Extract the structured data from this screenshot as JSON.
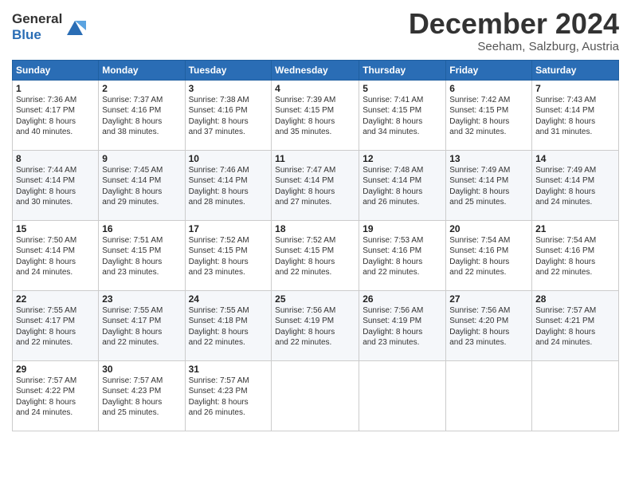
{
  "header": {
    "logo_line1": "General",
    "logo_line2": "Blue",
    "month_title": "December 2024",
    "location": "Seeham, Salzburg, Austria"
  },
  "calendar": {
    "days_of_week": [
      "Sunday",
      "Monday",
      "Tuesday",
      "Wednesday",
      "Thursday",
      "Friday",
      "Saturday"
    ],
    "weeks": [
      [
        {
          "day": "",
          "info": ""
        },
        {
          "day": "2",
          "info": "Sunrise: 7:37 AM\nSunset: 4:16 PM\nDaylight: 8 hours\nand 38 minutes."
        },
        {
          "day": "3",
          "info": "Sunrise: 7:38 AM\nSunset: 4:16 PM\nDaylight: 8 hours\nand 37 minutes."
        },
        {
          "day": "4",
          "info": "Sunrise: 7:39 AM\nSunset: 4:15 PM\nDaylight: 8 hours\nand 35 minutes."
        },
        {
          "day": "5",
          "info": "Sunrise: 7:41 AM\nSunset: 4:15 PM\nDaylight: 8 hours\nand 34 minutes."
        },
        {
          "day": "6",
          "info": "Sunrise: 7:42 AM\nSunset: 4:15 PM\nDaylight: 8 hours\nand 32 minutes."
        },
        {
          "day": "7",
          "info": "Sunrise: 7:43 AM\nSunset: 4:14 PM\nDaylight: 8 hours\nand 31 minutes."
        }
      ],
      [
        {
          "day": "1",
          "info": "Sunrise: 7:36 AM\nSunset: 4:17 PM\nDaylight: 8 hours\nand 40 minutes."
        },
        {
          "day": "9",
          "info": "Sunrise: 7:45 AM\nSunset: 4:14 PM\nDaylight: 8 hours\nand 29 minutes."
        },
        {
          "day": "10",
          "info": "Sunrise: 7:46 AM\nSunset: 4:14 PM\nDaylight: 8 hours\nand 28 minutes."
        },
        {
          "day": "11",
          "info": "Sunrise: 7:47 AM\nSunset: 4:14 PM\nDaylight: 8 hours\nand 27 minutes."
        },
        {
          "day": "12",
          "info": "Sunrise: 7:48 AM\nSunset: 4:14 PM\nDaylight: 8 hours\nand 26 minutes."
        },
        {
          "day": "13",
          "info": "Sunrise: 7:49 AM\nSunset: 4:14 PM\nDaylight: 8 hours\nand 25 minutes."
        },
        {
          "day": "14",
          "info": "Sunrise: 7:49 AM\nSunset: 4:14 PM\nDaylight: 8 hours\nand 24 minutes."
        }
      ],
      [
        {
          "day": "8",
          "info": "Sunrise: 7:44 AM\nSunset: 4:14 PM\nDaylight: 8 hours\nand 30 minutes."
        },
        {
          "day": "16",
          "info": "Sunrise: 7:51 AM\nSunset: 4:15 PM\nDaylight: 8 hours\nand 23 minutes."
        },
        {
          "day": "17",
          "info": "Sunrise: 7:52 AM\nSunset: 4:15 PM\nDaylight: 8 hours\nand 23 minutes."
        },
        {
          "day": "18",
          "info": "Sunrise: 7:52 AM\nSunset: 4:15 PM\nDaylight: 8 hours\nand 22 minutes."
        },
        {
          "day": "19",
          "info": "Sunrise: 7:53 AM\nSunset: 4:16 PM\nDaylight: 8 hours\nand 22 minutes."
        },
        {
          "day": "20",
          "info": "Sunrise: 7:54 AM\nSunset: 4:16 PM\nDaylight: 8 hours\nand 22 minutes."
        },
        {
          "day": "21",
          "info": "Sunrise: 7:54 AM\nSunset: 4:16 PM\nDaylight: 8 hours\nand 22 minutes."
        }
      ],
      [
        {
          "day": "15",
          "info": "Sunrise: 7:50 AM\nSunset: 4:14 PM\nDaylight: 8 hours\nand 24 minutes."
        },
        {
          "day": "23",
          "info": "Sunrise: 7:55 AM\nSunset: 4:17 PM\nDaylight: 8 hours\nand 22 minutes."
        },
        {
          "day": "24",
          "info": "Sunrise: 7:55 AM\nSunset: 4:18 PM\nDaylight: 8 hours\nand 22 minutes."
        },
        {
          "day": "25",
          "info": "Sunrise: 7:56 AM\nSunset: 4:19 PM\nDaylight: 8 hours\nand 22 minutes."
        },
        {
          "day": "26",
          "info": "Sunrise: 7:56 AM\nSunset: 4:19 PM\nDaylight: 8 hours\nand 23 minutes."
        },
        {
          "day": "27",
          "info": "Sunrise: 7:56 AM\nSunset: 4:20 PM\nDaylight: 8 hours\nand 23 minutes."
        },
        {
          "day": "28",
          "info": "Sunrise: 7:57 AM\nSunset: 4:21 PM\nDaylight: 8 hours\nand 24 minutes."
        }
      ],
      [
        {
          "day": "22",
          "info": "Sunrise: 7:55 AM\nSunset: 4:17 PM\nDaylight: 8 hours\nand 22 minutes."
        },
        {
          "day": "30",
          "info": "Sunrise: 7:57 AM\nSunset: 4:23 PM\nDaylight: 8 hours\nand 25 minutes."
        },
        {
          "day": "31",
          "info": "Sunrise: 7:57 AM\nSunset: 4:23 PM\nDaylight: 8 hours\nand 26 minutes."
        },
        {
          "day": "",
          "info": ""
        },
        {
          "day": "",
          "info": ""
        },
        {
          "day": "",
          "info": ""
        },
        {
          "day": "",
          "info": ""
        }
      ],
      [
        {
          "day": "29",
          "info": "Sunrise: 7:57 AM\nSunset: 4:22 PM\nDaylight: 8 hours\nand 24 minutes."
        },
        {
          "day": "",
          "info": ""
        },
        {
          "day": "",
          "info": ""
        },
        {
          "day": "",
          "info": ""
        },
        {
          "day": "",
          "info": ""
        },
        {
          "day": "",
          "info": ""
        },
        {
          "day": "",
          "info": ""
        }
      ]
    ]
  }
}
